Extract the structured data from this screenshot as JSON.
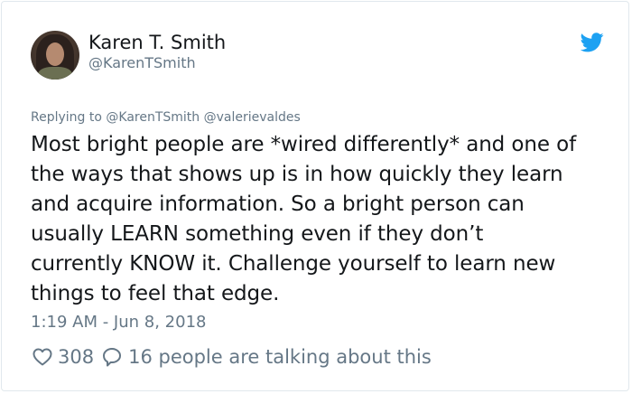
{
  "tweet": {
    "display_name": "Karen T. Smith",
    "handle": "@KarenTSmith",
    "replying_to": "Replying to @KarenTSmith @valerievaldes",
    "text": "Most bright people are *wired differently* and one of\nthe ways that shows up is in how quickly they learn\nand acquire information. So a bright person can\nusually LEARN something even if they don’t\ncurrently KNOW it. Challenge yourself to learn new\nthings to feel that edge.",
    "timestamp": "1:19 AM - Jun 8, 2018",
    "like_count": "308",
    "talking": "16 people are talking about this"
  },
  "icons": {
    "brand": "twitter-bird-icon",
    "like": "heart-icon",
    "reply": "speech-bubble-icon"
  },
  "colors": {
    "brand": "#1da1f2",
    "text": "#14171a",
    "secondary": "#657786",
    "border": "#e1e8ed"
  }
}
